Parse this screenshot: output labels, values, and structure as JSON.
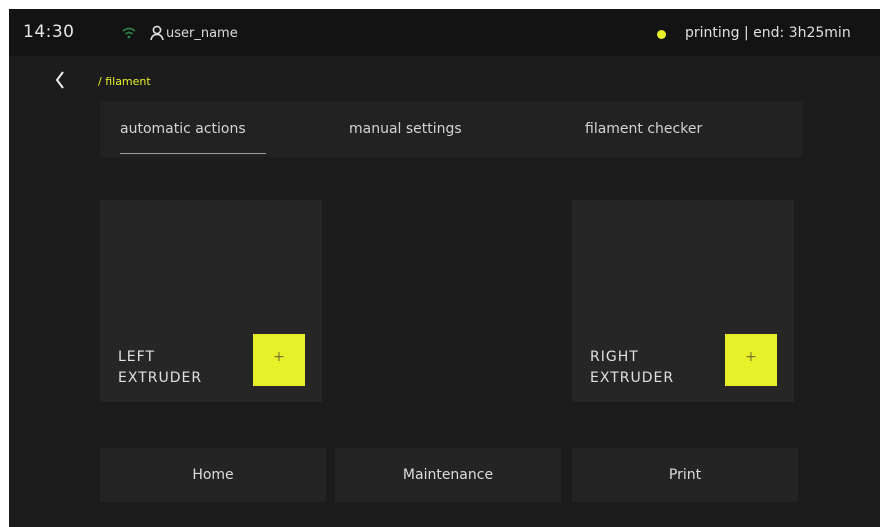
{
  "status": {
    "time": "14:30",
    "user_name": "user_name",
    "job_status": "printing | end: 3h25min",
    "indicator_color": "#e8f02a"
  },
  "breadcrumb": "/ filament",
  "tabs": [
    {
      "label": "automatic actions",
      "active": true
    },
    {
      "label": "manual settings",
      "active": false
    },
    {
      "label": "filament checker",
      "active": false
    }
  ],
  "extruders": {
    "left": {
      "label": "LEFT\nEXTRUDER",
      "button": "+"
    },
    "right": {
      "label": "RIGHT\nEXTRUDER",
      "button": "+"
    }
  },
  "nav": {
    "home": "Home",
    "maintenance": "Maintenance",
    "print": "Print"
  },
  "icons": {
    "wifi": "wifi-icon",
    "user": "user-icon",
    "back": "chevron-left-icon"
  },
  "colors": {
    "accent": "#e8f02a",
    "background": "#1c1c1c",
    "panel": "#262626"
  }
}
